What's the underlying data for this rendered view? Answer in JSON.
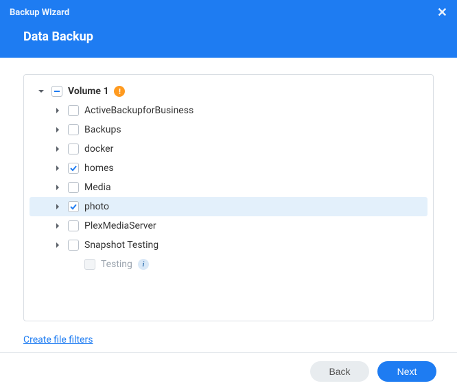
{
  "header": {
    "title_small": "Backup Wizard",
    "subtitle": "Data Backup"
  },
  "tree": {
    "root": {
      "label": "Volume 1"
    },
    "items": [
      {
        "label": "ActiveBackupforBusiness"
      },
      {
        "label": "Backups"
      },
      {
        "label": "docker"
      },
      {
        "label": "homes"
      },
      {
        "label": "Media"
      },
      {
        "label": "photo"
      },
      {
        "label": "PlexMediaServer"
      },
      {
        "label": "Snapshot Testing"
      },
      {
        "label": "Testing"
      }
    ]
  },
  "links": {
    "create_file_filters": "Create file filters"
  },
  "footer": {
    "back": "Back",
    "next": "Next"
  }
}
